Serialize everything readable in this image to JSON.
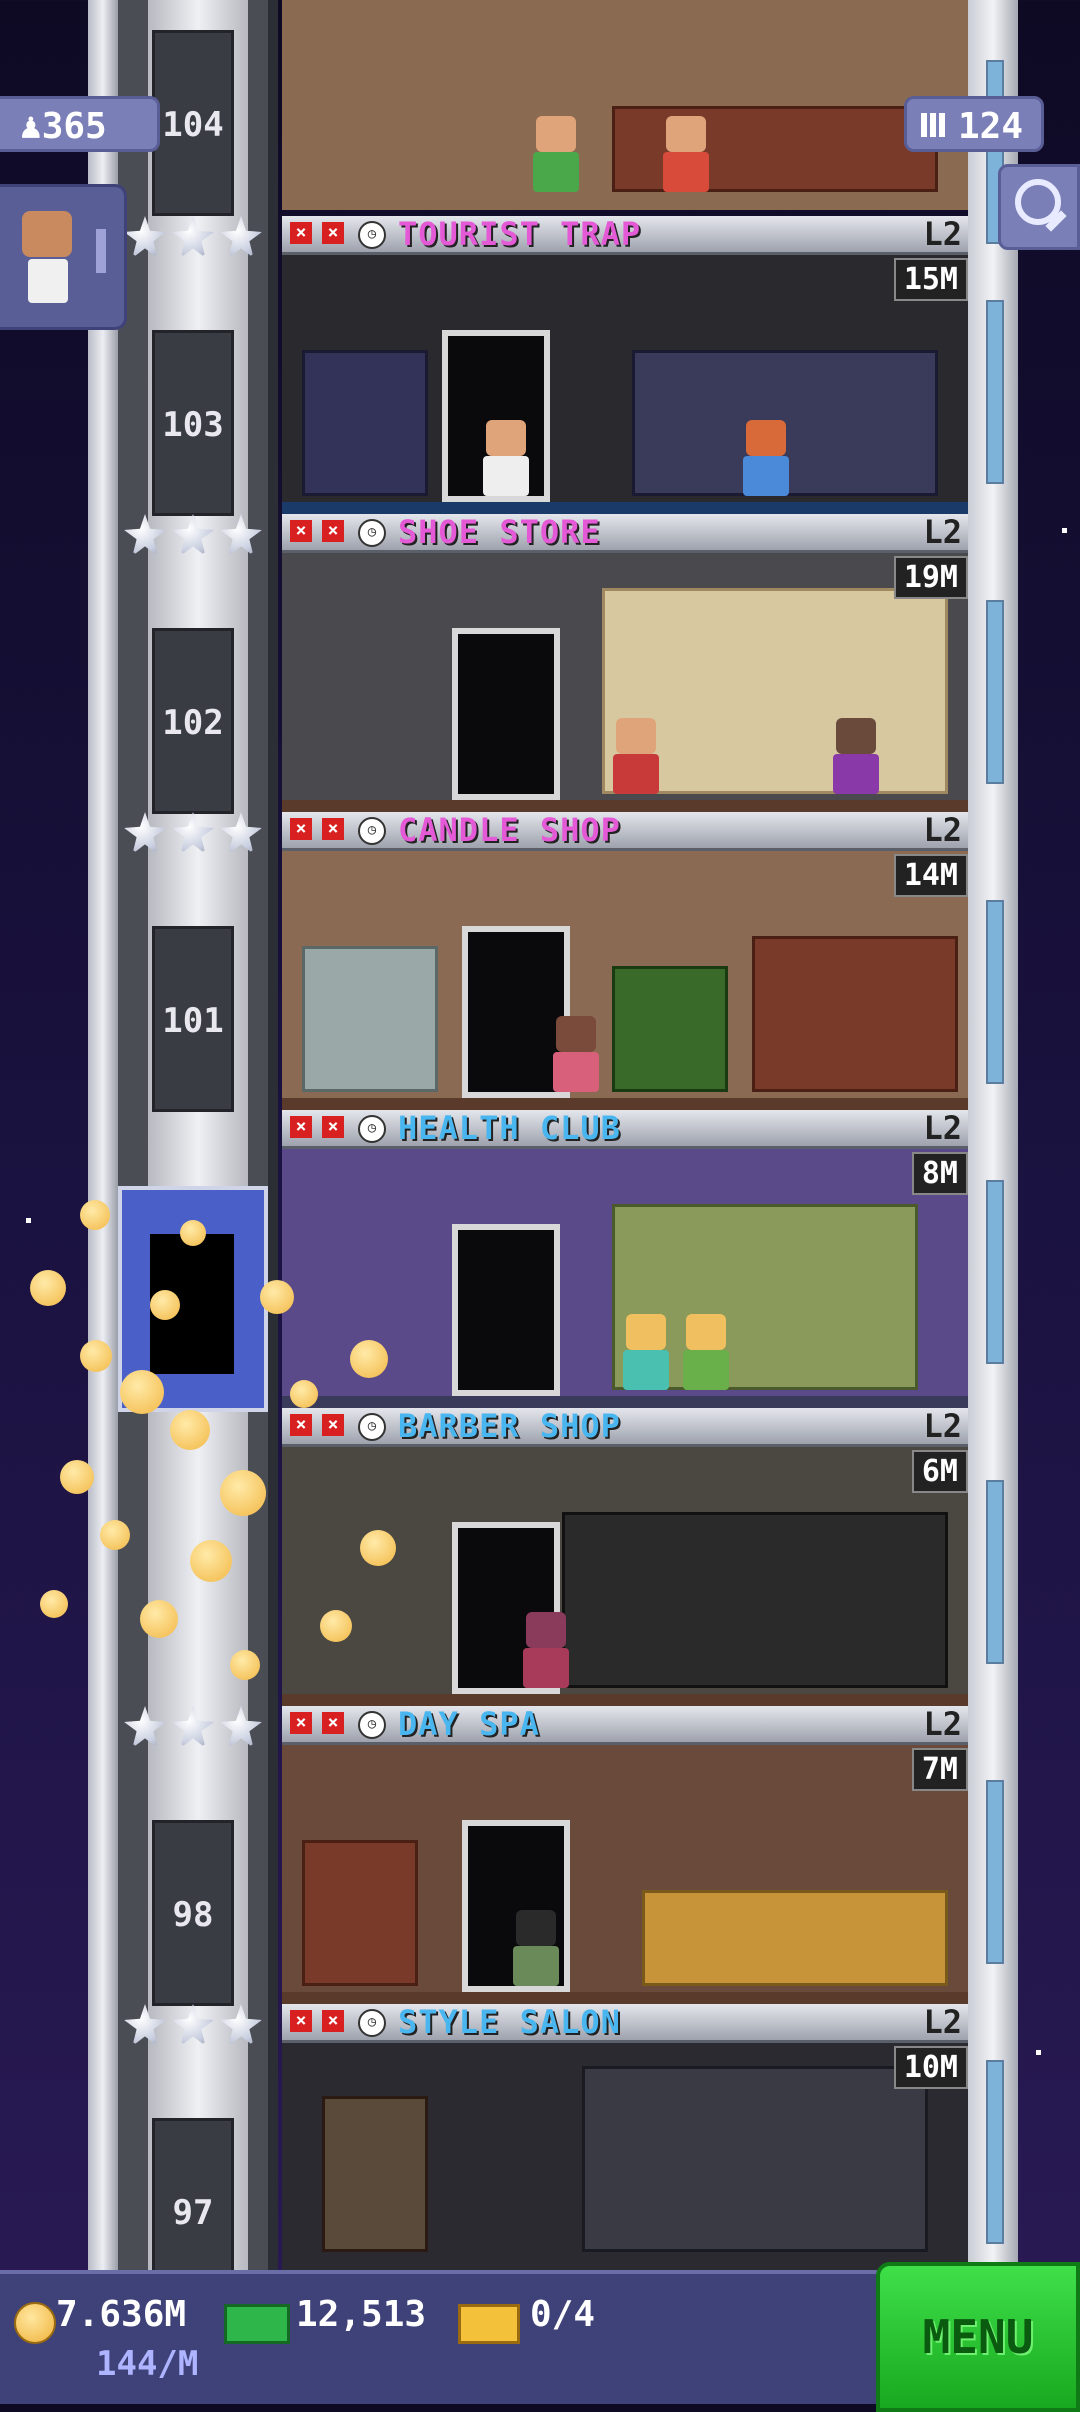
{
  "hud": {
    "population": "365",
    "floor_count": "124",
    "coins": "7.636M",
    "coin_rate": "144/M",
    "bux": "12,513",
    "vip_tickets": "0/4",
    "menu_label": "MENU"
  },
  "icons": {
    "population": "person-icon",
    "floors": "building-icon",
    "search": "magnifier-icon",
    "coin": "coin-icon",
    "bux": "banknote-icon",
    "ticket": "golden-ticket-icon"
  },
  "tower": {
    "top_floor_number": "104",
    "floors": [
      {
        "shaft_number": "103",
        "name": "TOURIST TRAP",
        "level": "L2",
        "earnings": "15M",
        "color": "#e45ad6"
      },
      {
        "shaft_number": "102",
        "name": "SHOE STORE",
        "level": "L2",
        "earnings": "19M",
        "color": "#e45ad6"
      },
      {
        "shaft_number": "101",
        "name": "CANDLE SHOP",
        "level": "L2",
        "earnings": "14M",
        "color": "#e45ad6"
      },
      {
        "shaft_number": "",
        "name": "HEALTH CLUB",
        "level": "L2",
        "earnings": "8M",
        "color": "#4ab6f0"
      },
      {
        "shaft_number": "",
        "name": "BARBER SHOP",
        "level": "L2",
        "earnings": "6M",
        "color": "#4ab6f0"
      },
      {
        "shaft_number": "98",
        "name": "DAY SPA",
        "level": "L2",
        "earnings": "7M",
        "color": "#4ab6f0"
      },
      {
        "shaft_number": "97",
        "name": "STYLE SALON",
        "level": "L2",
        "earnings": "10M",
        "color": "#4ab6f0"
      }
    ]
  }
}
